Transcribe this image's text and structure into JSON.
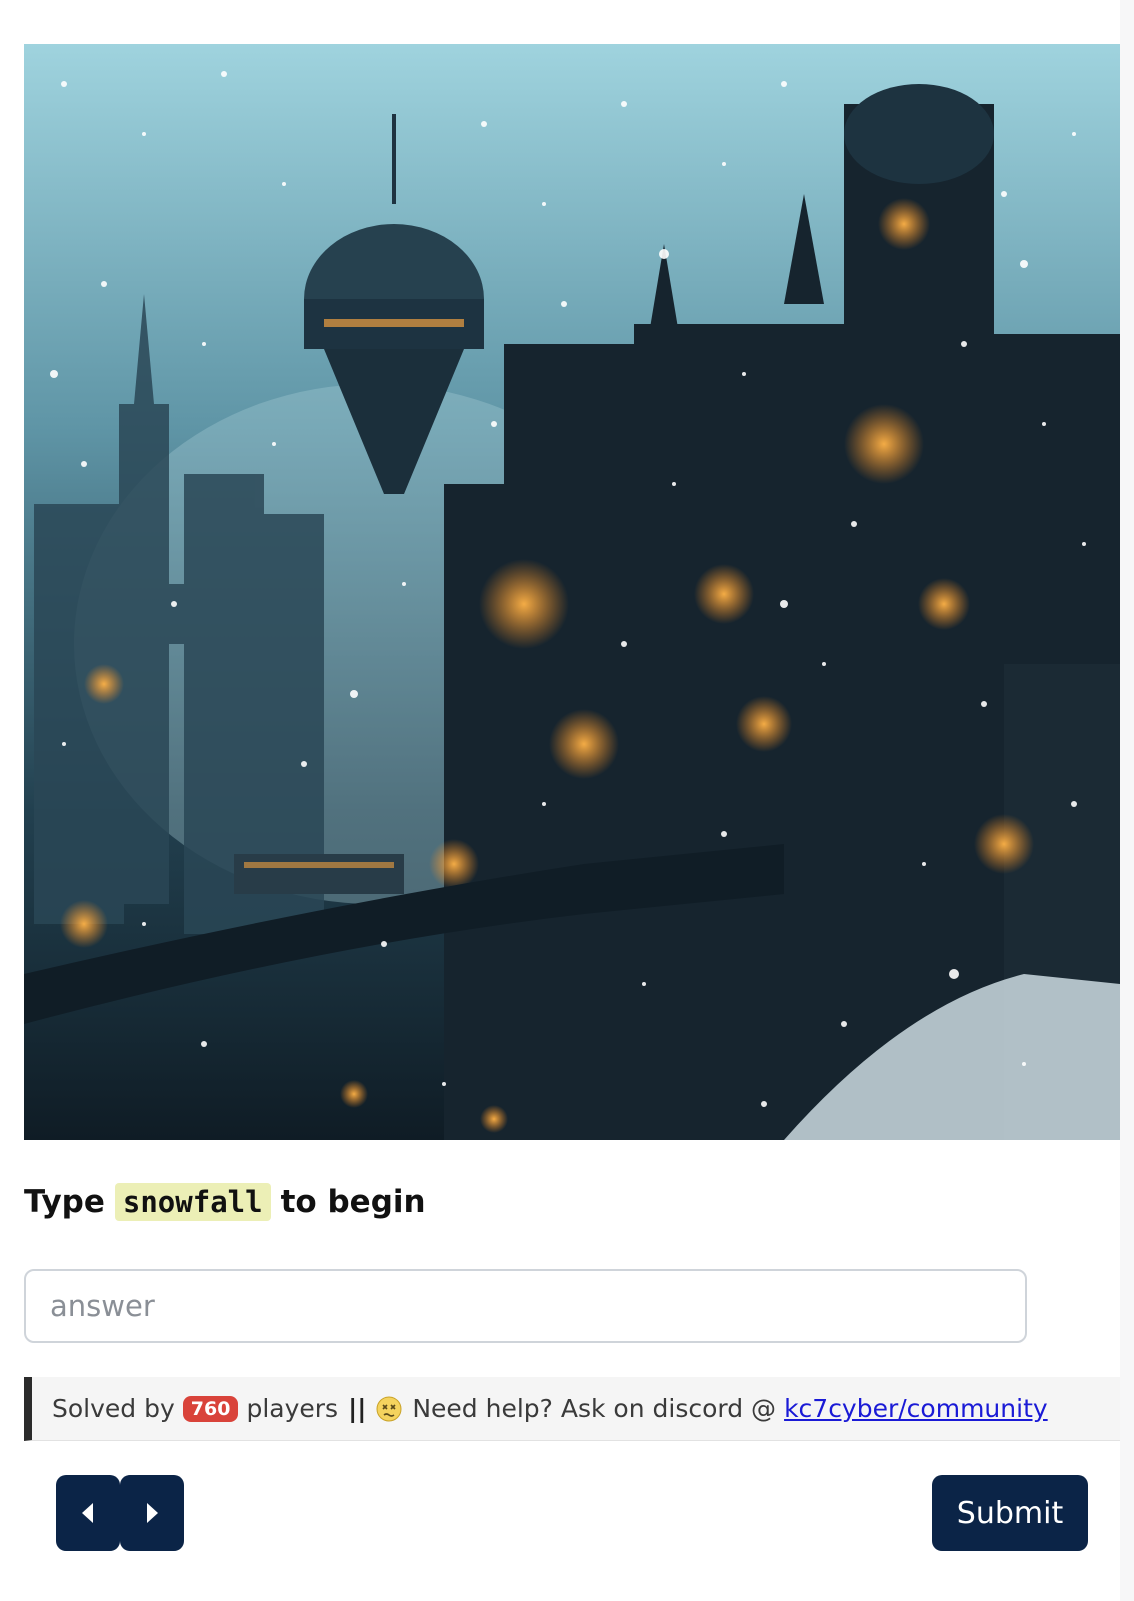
{
  "hero": {
    "alt_name": "snowy steampunk city illustration"
  },
  "prompt": {
    "prefix": "Type",
    "code": "snowfall",
    "suffix": "to begin"
  },
  "answer": {
    "placeholder": "answer",
    "value": ""
  },
  "info": {
    "solved_prefix": "Solved by",
    "solved_count": "760",
    "solved_suffix": "players",
    "separator": "||",
    "help_text": "Need help? Ask on discord @",
    "link_text": "kc7cyber/community",
    "emoji": "dizzy-face-icon"
  },
  "nav": {
    "prev_icon": "caret-left-icon",
    "next_icon": "caret-right-icon"
  },
  "submit": {
    "label": "Submit"
  },
  "colors": {
    "primary": "#0b2447",
    "badge": "#d9433a",
    "code_bg": "#ecefb6",
    "link": "#1a1ad6"
  }
}
